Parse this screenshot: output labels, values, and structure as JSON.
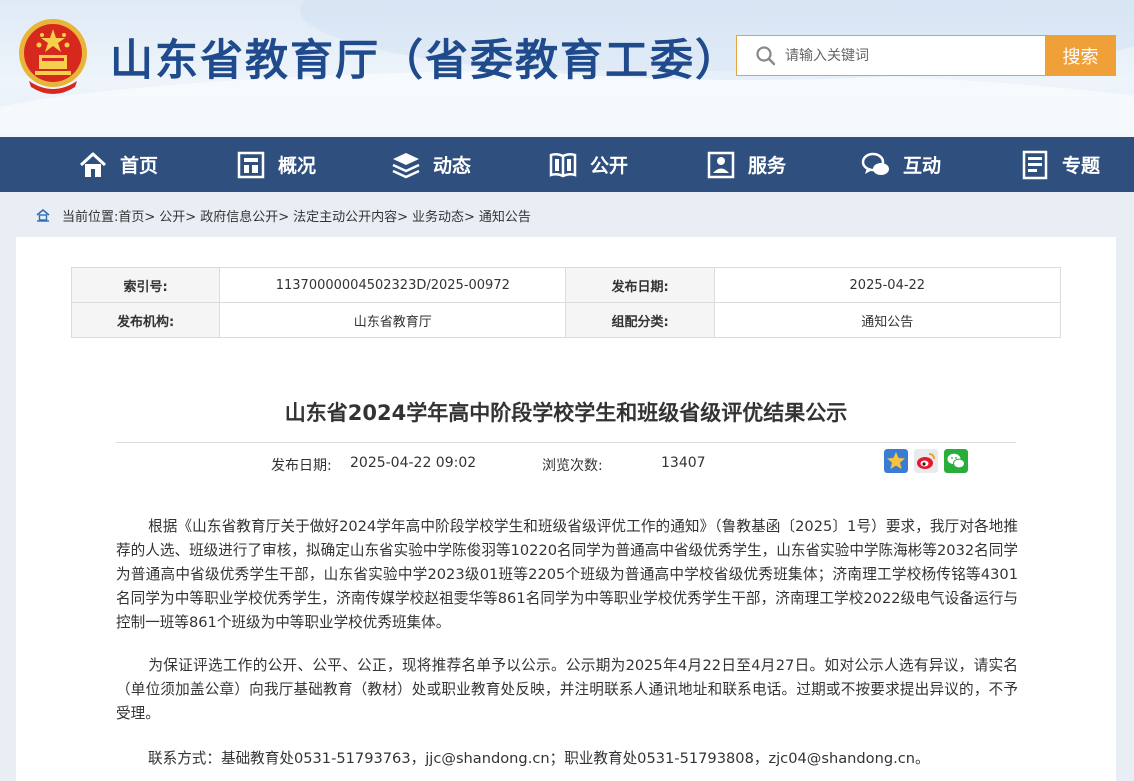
{
  "header": {
    "site_title": "山东省教育厅（省委教育工委）",
    "search_placeholder": "请输入关键词",
    "search_button": "搜索"
  },
  "nav": {
    "items": [
      {
        "label": "首页",
        "icon": "home-icon"
      },
      {
        "label": "概况",
        "icon": "building-icon"
      },
      {
        "label": "动态",
        "icon": "stack-icon"
      },
      {
        "label": "公开",
        "icon": "book-icon"
      },
      {
        "label": "服务",
        "icon": "service-icon"
      },
      {
        "label": "互动",
        "icon": "chat-icon"
      },
      {
        "label": "专题",
        "icon": "document-icon"
      }
    ]
  },
  "breadcrumb": {
    "prefix": "当前位置:",
    "items": [
      "首页>",
      "公开>",
      "政府信息公开>",
      "法定主动公开内容>",
      "业务动态>",
      "通知公告"
    ]
  },
  "meta": {
    "index_label": "索引号:",
    "index_value": "11370000004502323D/2025-00972",
    "pub_date_label": "发布日期:",
    "pub_date_value": "2025-04-22",
    "org_label": "发布机构:",
    "org_value": "山东省教育厅",
    "category_label": "组配分类:",
    "category_value": "通知公告"
  },
  "article": {
    "title": "山东省2024学年高中阶段学校学生和班级省级评优结果公示",
    "pub_label": "发布日期:",
    "pub_time": "2025-04-22 09:02",
    "views_label": "浏览次数:",
    "views_count": "13407",
    "paragraphs": [
      "根据《山东省教育厅关于做好2024学年高中阶段学校学生和班级省级评优工作的通知》（鲁教基函〔2025〕1号）要求，我厅对各地推荐的人选、班级进行了审核，拟确定山东省实验中学陈俊羽等10220名同学为普通高中省级优秀学生，山东省实验中学陈海彬等2032名同学为普通高中省级优秀学生干部，山东省实验中学2023级01班等2205个班级为普通高中学校省级优秀班集体；济南理工学校杨传铭等4301名同学为中等职业学校优秀学生，济南传媒学校赵祖雯华等861名同学为中等职业学校优秀学生干部，济南理工学校2022级电气设备运行与控制一班等861个班级为中等职业学校优秀班集体。",
      "为保证评选工作的公开、公平、公正，现将推荐名单予以公示。公示期为2025年4月22日至4月27日。如对公示人选有异议，请实名（单位须加盖公章）向我厅基础教育（教材）处或职业教育处反映，并注明联系人通讯地址和联系电话。过期或不按要求提出异议的，不予受理。",
      "联系方式：基础教育处0531-51793763，jjc@shandong.cn；职业教育处0531-51793808，zjc04@shandong.cn。"
    ]
  },
  "colors": {
    "nav_bg": "#2f4f7e",
    "title_blue": "#1f4a8c",
    "search_orange": "#f0a038"
  }
}
